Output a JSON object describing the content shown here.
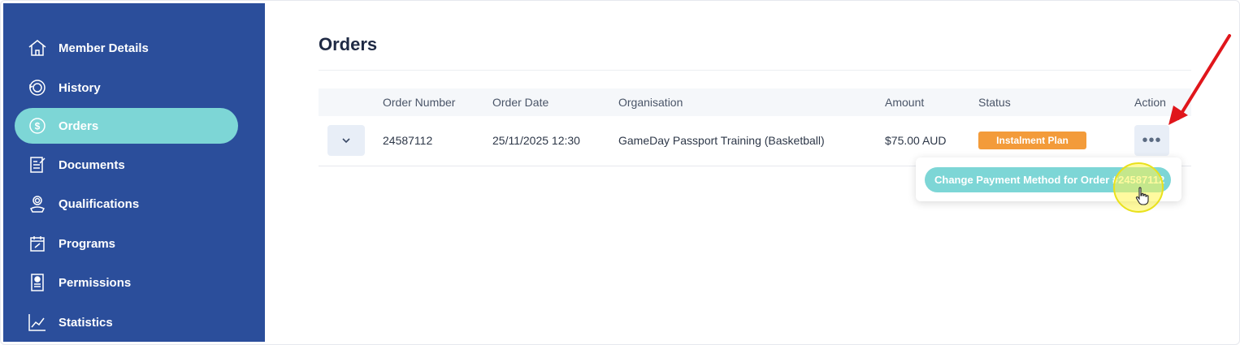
{
  "sidebar": {
    "items": [
      {
        "label": "Member Details",
        "icon": "home-icon",
        "active": false
      },
      {
        "label": "History",
        "icon": "history-icon",
        "active": false
      },
      {
        "label": "Orders",
        "icon": "dollar-icon",
        "active": true
      },
      {
        "label": "Documents",
        "icon": "document-icon",
        "active": false
      },
      {
        "label": "Qualifications",
        "icon": "qualification-icon",
        "active": false
      },
      {
        "label": "Programs",
        "icon": "calendar-icon",
        "active": false
      },
      {
        "label": "Permissions",
        "icon": "permissions-icon",
        "active": false
      },
      {
        "label": "Statistics",
        "icon": "chart-icon",
        "active": false
      }
    ]
  },
  "main": {
    "title": "Orders",
    "columns": [
      "Order Number",
      "Order Date",
      "Organisation",
      "Amount",
      "Status",
      "Action"
    ],
    "rows": [
      {
        "order_number": "24587112",
        "order_date": "25/11/2025 12:30",
        "organisation": "GameDay Passport Training (Basketball)",
        "amount": "$75.00 AUD",
        "status": "Instalment Plan"
      }
    ],
    "action_menu": {
      "items": [
        "Change Payment Method for Order #24587112"
      ]
    }
  },
  "colors": {
    "sidebar_bg": "#2b4e9b",
    "active_item": "#7dd6d6",
    "status_badge": "#f39b3a",
    "annotation_arrow": "#e0161b"
  }
}
